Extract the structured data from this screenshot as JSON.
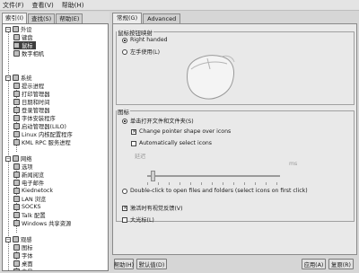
{
  "menubar": [
    "文件(F)",
    "查看(V)",
    "帮助(H)"
  ],
  "left_tabs": [
    "索引(I)",
    "查找(S)",
    "帮助(E)"
  ],
  "tree": [
    "外设",
    "键盘",
    "鼠标",
    "数字相机",
    "系统",
    "提示进程",
    "打印管理器",
    "日期和时间",
    "登录管理器",
    "字体安装程序",
    "启动管理器(LILO)",
    "Linux 内核配置程序",
    "KML RPC 服务进程",
    "网络",
    "选项",
    "新闻阅览",
    "电子邮件",
    "Kiednetock",
    "LAN 浏览",
    "SOCKS",
    "Talk 配置",
    "Windows 共享资源",
    "观感",
    "图标",
    "字体",
    "桌面",
    "背景",
    "面板"
  ],
  "right_tabs": [
    "常规(G)",
    "Advanced"
  ],
  "button_mapping": {
    "title": "鼠标按钮映射",
    "right_handed": "Right handed",
    "left_handed": "左手使用(L)"
  },
  "icons_group": {
    "title": "图标",
    "single_click": "单击打开文件和文件夹(S)",
    "change_pointer": "Change pointer shape over icons",
    "auto_select": "Automatically select icons",
    "delay_label": "延迟",
    "delay_value": "ms",
    "double_click": "Double-click to open files and folders (select icons on first click)"
  },
  "visual_feedback": "激活时有视觉反馈(V)",
  "large_cursor": "大光标(L)",
  "buttons": {
    "help": "帮助(H)",
    "defaults": "默认值(D)",
    "apply": "应用(A)",
    "reset": "复原(R)"
  },
  "state": {
    "mapping": "right_handed",
    "click_mode": "single_click",
    "change_pointer": true,
    "auto_select": false,
    "visual_feedback": true,
    "large_cursor": false,
    "selected_tree_item": "鼠标"
  }
}
